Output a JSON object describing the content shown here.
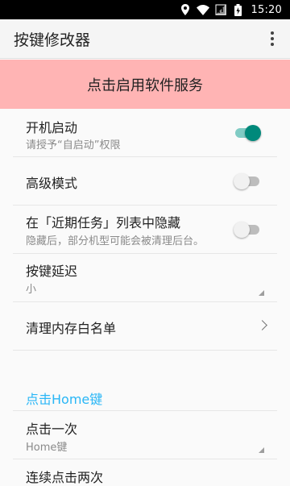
{
  "status_bar": {
    "time": "15:20",
    "icons": [
      "location-icon",
      "wifi-icon",
      "signal-icon",
      "battery-icon"
    ]
  },
  "app_bar": {
    "title": "按键修改器",
    "overflow_icon": "more-vert-icon"
  },
  "banner": {
    "label": "点击启用软件服务",
    "color": "#ffb4b4"
  },
  "settings": {
    "boot_start": {
      "title": "开机启动",
      "subtitle": "请授予“自启动”权限",
      "enabled": true
    },
    "advanced_mode": {
      "title": "高级模式",
      "enabled": false
    },
    "hide_recents": {
      "title": "在「近期任务」列表中隐藏",
      "subtitle": "隐藏后，部分机型可能会被清理后台。",
      "enabled": false
    },
    "key_delay": {
      "title": "按键延迟",
      "value": "小"
    },
    "whitelist": {
      "title": "清理内存白名单"
    }
  },
  "section_home": {
    "header": "点击Home键",
    "header_color": "#29b6f6",
    "single_click": {
      "title": "点击一次",
      "value": "Home键"
    },
    "double_click": {
      "title": "连续点击两次"
    }
  },
  "colors": {
    "accent": "#00897b",
    "accent_track": "#80cbc4",
    "status_bar": "#000000"
  }
}
